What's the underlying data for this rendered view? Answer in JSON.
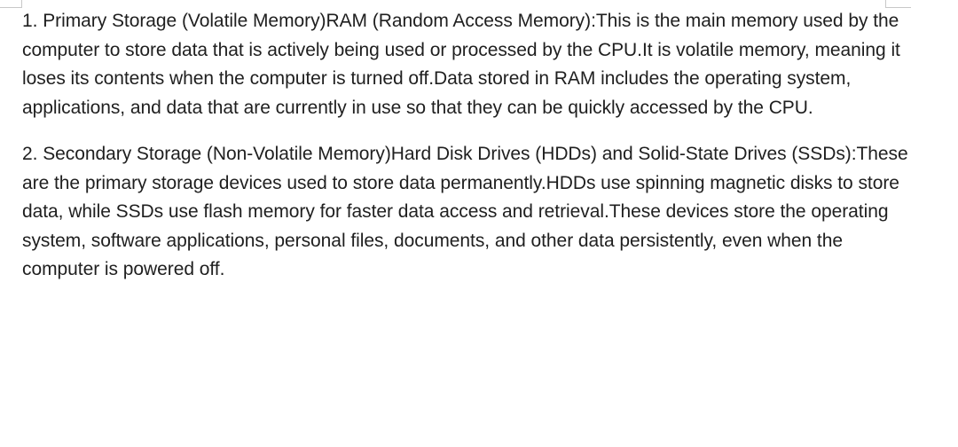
{
  "document": {
    "paragraphs": [
      "1. Primary Storage (Volatile Memory)RAM (Random Access Memory):This is the main memory used by the computer to store data that is actively being used or processed by the CPU.It is volatile memory, meaning it loses its contents when the computer is turned off.Data stored in RAM includes the operating system, applications, and data that are currently in use so that they can be quickly accessed by the CPU.",
      "2. Secondary Storage (Non-Volatile Memory)Hard Disk Drives (HDDs) and Solid-State Drives (SSDs):These are the primary storage devices used to store data permanently.HDDs use spinning magnetic disks to store data, while SSDs use flash memory for faster data access and retrieval.These devices store the operating system, software applications, personal files, documents, and other data persistently, even when the computer is powered off."
    ]
  },
  "colors": {
    "text": "#1f1f1f",
    "background": "#ffffff",
    "margin_marks": "#c8c8c8"
  }
}
